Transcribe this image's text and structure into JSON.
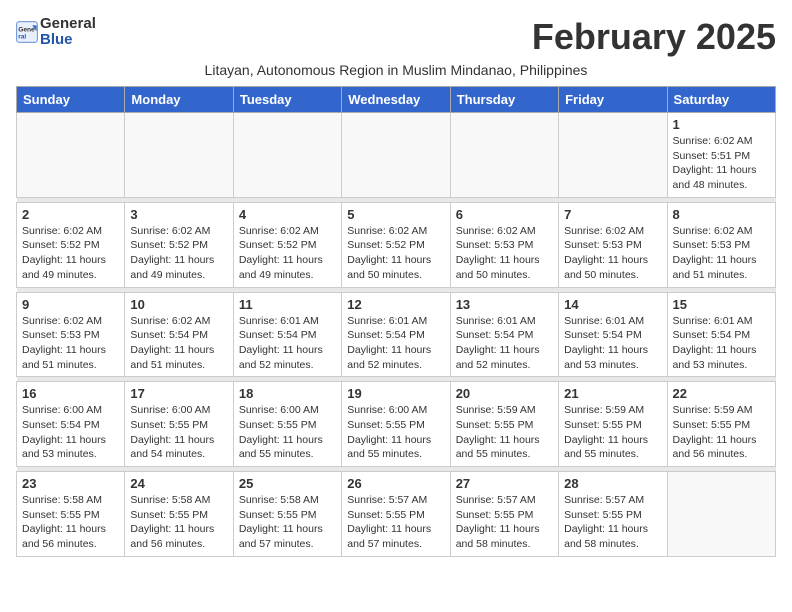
{
  "logo": {
    "general": "General",
    "blue": "Blue"
  },
  "title": "February 2025",
  "subtitle": "Litayan, Autonomous Region in Muslim Mindanao, Philippines",
  "weekdays": [
    "Sunday",
    "Monday",
    "Tuesday",
    "Wednesday",
    "Thursday",
    "Friday",
    "Saturday"
  ],
  "weeks": [
    [
      {
        "day": "",
        "info": ""
      },
      {
        "day": "",
        "info": ""
      },
      {
        "day": "",
        "info": ""
      },
      {
        "day": "",
        "info": ""
      },
      {
        "day": "",
        "info": ""
      },
      {
        "day": "",
        "info": ""
      },
      {
        "day": "1",
        "info": "Sunrise: 6:02 AM\nSunset: 5:51 PM\nDaylight: 11 hours and 48 minutes."
      }
    ],
    [
      {
        "day": "2",
        "info": "Sunrise: 6:02 AM\nSunset: 5:52 PM\nDaylight: 11 hours and 49 minutes."
      },
      {
        "day": "3",
        "info": "Sunrise: 6:02 AM\nSunset: 5:52 PM\nDaylight: 11 hours and 49 minutes."
      },
      {
        "day": "4",
        "info": "Sunrise: 6:02 AM\nSunset: 5:52 PM\nDaylight: 11 hours and 49 minutes."
      },
      {
        "day": "5",
        "info": "Sunrise: 6:02 AM\nSunset: 5:52 PM\nDaylight: 11 hours and 50 minutes."
      },
      {
        "day": "6",
        "info": "Sunrise: 6:02 AM\nSunset: 5:53 PM\nDaylight: 11 hours and 50 minutes."
      },
      {
        "day": "7",
        "info": "Sunrise: 6:02 AM\nSunset: 5:53 PM\nDaylight: 11 hours and 50 minutes."
      },
      {
        "day": "8",
        "info": "Sunrise: 6:02 AM\nSunset: 5:53 PM\nDaylight: 11 hours and 51 minutes."
      }
    ],
    [
      {
        "day": "9",
        "info": "Sunrise: 6:02 AM\nSunset: 5:53 PM\nDaylight: 11 hours and 51 minutes."
      },
      {
        "day": "10",
        "info": "Sunrise: 6:02 AM\nSunset: 5:54 PM\nDaylight: 11 hours and 51 minutes."
      },
      {
        "day": "11",
        "info": "Sunrise: 6:01 AM\nSunset: 5:54 PM\nDaylight: 11 hours and 52 minutes."
      },
      {
        "day": "12",
        "info": "Sunrise: 6:01 AM\nSunset: 5:54 PM\nDaylight: 11 hours and 52 minutes."
      },
      {
        "day": "13",
        "info": "Sunrise: 6:01 AM\nSunset: 5:54 PM\nDaylight: 11 hours and 52 minutes."
      },
      {
        "day": "14",
        "info": "Sunrise: 6:01 AM\nSunset: 5:54 PM\nDaylight: 11 hours and 53 minutes."
      },
      {
        "day": "15",
        "info": "Sunrise: 6:01 AM\nSunset: 5:54 PM\nDaylight: 11 hours and 53 minutes."
      }
    ],
    [
      {
        "day": "16",
        "info": "Sunrise: 6:00 AM\nSunset: 5:54 PM\nDaylight: 11 hours and 53 minutes."
      },
      {
        "day": "17",
        "info": "Sunrise: 6:00 AM\nSunset: 5:55 PM\nDaylight: 11 hours and 54 minutes."
      },
      {
        "day": "18",
        "info": "Sunrise: 6:00 AM\nSunset: 5:55 PM\nDaylight: 11 hours and 55 minutes."
      },
      {
        "day": "19",
        "info": "Sunrise: 6:00 AM\nSunset: 5:55 PM\nDaylight: 11 hours and 55 minutes."
      },
      {
        "day": "20",
        "info": "Sunrise: 5:59 AM\nSunset: 5:55 PM\nDaylight: 11 hours and 55 minutes."
      },
      {
        "day": "21",
        "info": "Sunrise: 5:59 AM\nSunset: 5:55 PM\nDaylight: 11 hours and 55 minutes."
      },
      {
        "day": "22",
        "info": "Sunrise: 5:59 AM\nSunset: 5:55 PM\nDaylight: 11 hours and 56 minutes."
      }
    ],
    [
      {
        "day": "23",
        "info": "Sunrise: 5:58 AM\nSunset: 5:55 PM\nDaylight: 11 hours and 56 minutes."
      },
      {
        "day": "24",
        "info": "Sunrise: 5:58 AM\nSunset: 5:55 PM\nDaylight: 11 hours and 56 minutes."
      },
      {
        "day": "25",
        "info": "Sunrise: 5:58 AM\nSunset: 5:55 PM\nDaylight: 11 hours and 57 minutes."
      },
      {
        "day": "26",
        "info": "Sunrise: 5:57 AM\nSunset: 5:55 PM\nDaylight: 11 hours and 57 minutes."
      },
      {
        "day": "27",
        "info": "Sunrise: 5:57 AM\nSunset: 5:55 PM\nDaylight: 11 hours and 58 minutes."
      },
      {
        "day": "28",
        "info": "Sunrise: 5:57 AM\nSunset: 5:55 PM\nDaylight: 11 hours and 58 minutes."
      },
      {
        "day": "",
        "info": ""
      }
    ]
  ]
}
